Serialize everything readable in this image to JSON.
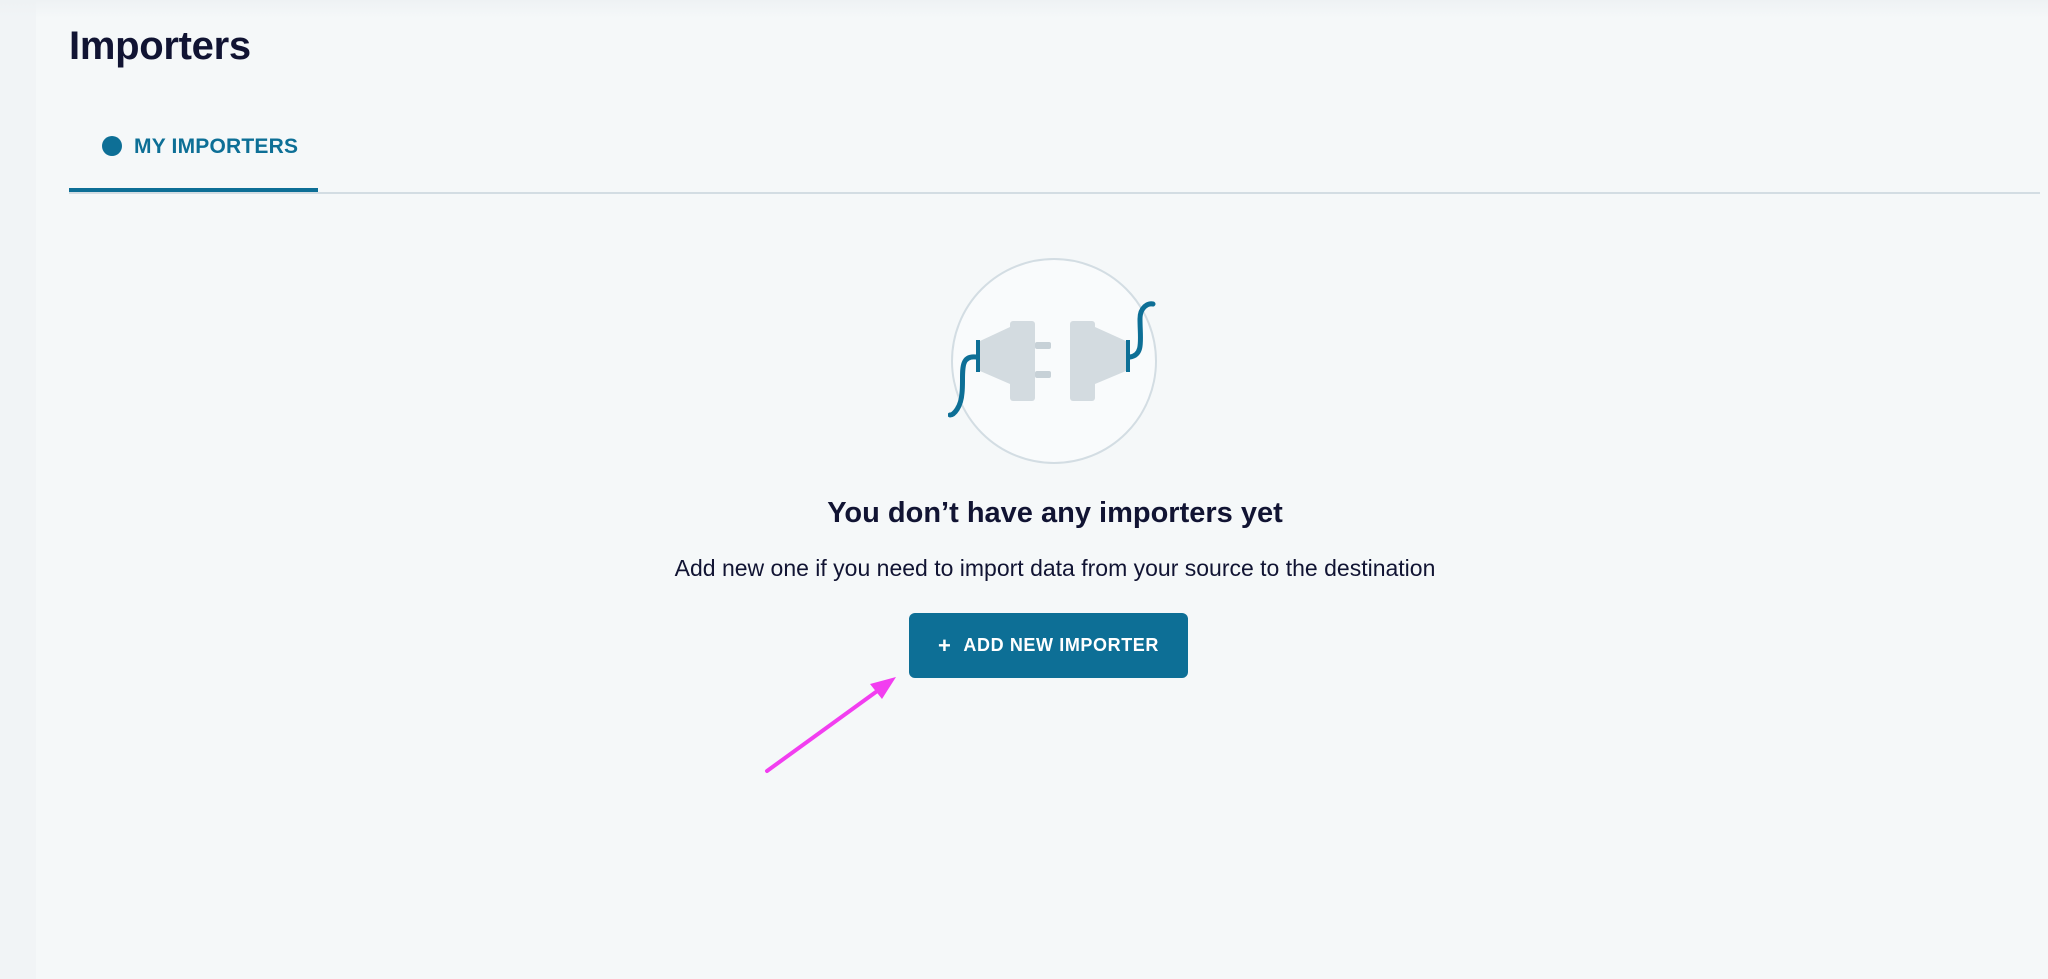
{
  "header": {
    "title": "Importers"
  },
  "tabs": [
    {
      "label": "MY IMPORTERS",
      "active": true
    }
  ],
  "empty_state": {
    "illustration_icon": "disconnected-plug-icon",
    "title": "You don’t have any importers yet",
    "subtitle": "Add new one if you need to import data from your source to the destination",
    "button": {
      "icon": "plus-icon",
      "plus_glyph": "+",
      "label": "ADD NEW IMPORTER"
    }
  },
  "annotation": {
    "icon": "pointer-arrow-icon",
    "color": "#f23ef0"
  },
  "colors": {
    "accent": "#0d6f96",
    "text": "#111433",
    "background": "#f5f8f9"
  }
}
